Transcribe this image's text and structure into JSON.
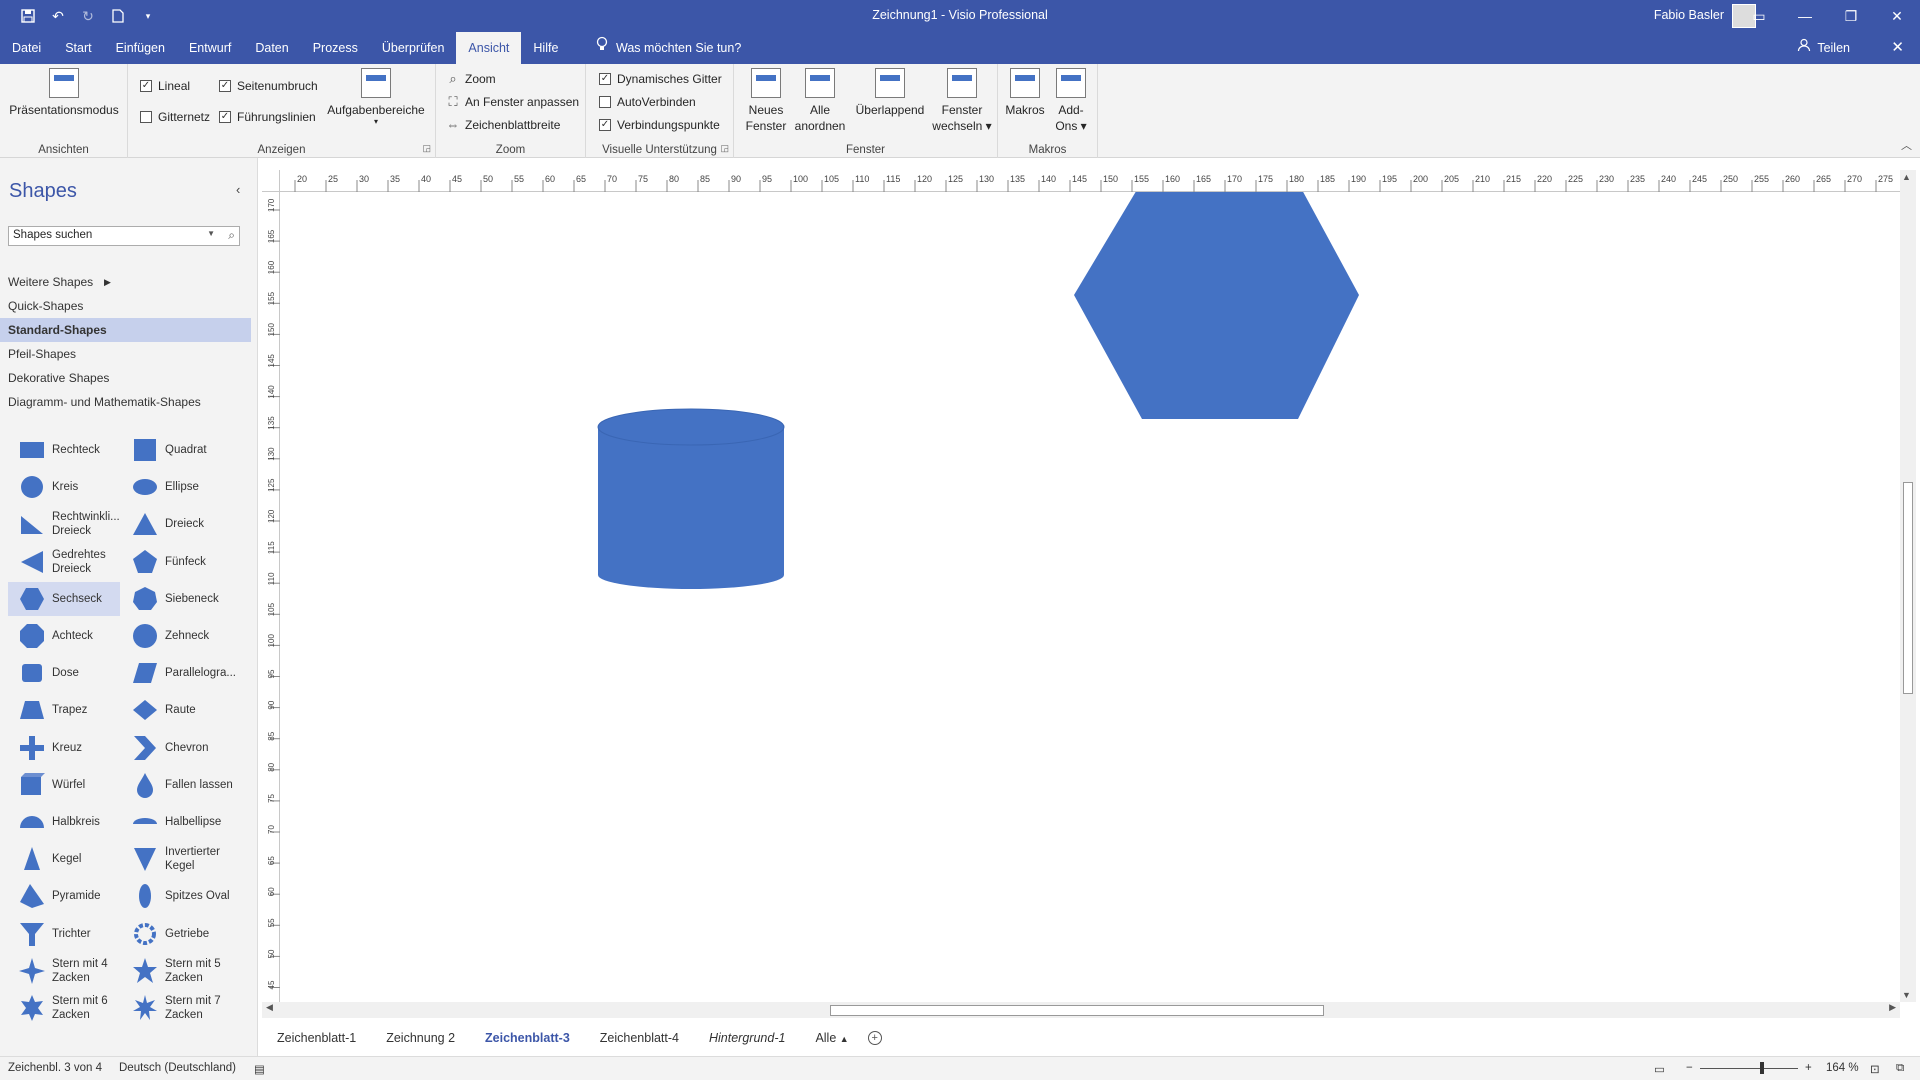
{
  "titlebar": {
    "title": "Zeichnung1  -  Visio Professional",
    "user": "Fabio Basler",
    "qat_icons": [
      "save-icon",
      "undo-icon",
      "redo-icon",
      "new-document-icon",
      "customize-qat-icon"
    ]
  },
  "menu": {
    "tabs": [
      "Datei",
      "Start",
      "Einfügen",
      "Entwurf",
      "Daten",
      "Prozess",
      "Überprüfen",
      "Ansicht",
      "Hilfe"
    ],
    "active_tab": "Ansicht",
    "tellme": "Was möchten Sie tun?",
    "share": "Teilen"
  },
  "ribbon": {
    "ansichten": {
      "label": "Ansichten",
      "presentation": "Präsentationsmodus"
    },
    "anzeigen": {
      "label": "Anzeigen",
      "lineal": "Lineal",
      "gitternetz": "Gitternetz",
      "seitenumbruch": "Seitenumbruch",
      "fuehrungslinien": "Führungslinien",
      "aufgabenbereiche": "Aufgabenbereiche"
    },
    "zoom": {
      "label": "Zoom",
      "zoom": "Zoom",
      "fit": "An Fenster anpassen",
      "pagewidth": "Zeichenblattbreite"
    },
    "visuell": {
      "label": "Visuelle Unterstützung",
      "dyngitter": "Dynamisches Gitter",
      "autoverbinden": "AutoVerbinden",
      "verbindungspunkte": "Verbindungspunkte"
    },
    "fenster": {
      "label": "Fenster",
      "neues_1": "Neues",
      "neues_2": "Fenster",
      "alle_1": "Alle",
      "alle_2": "anordnen",
      "ueberlappend": "Überlappend",
      "wechseln_1": "Fenster",
      "wechseln_2": "wechseln"
    },
    "makros": {
      "label": "Makros",
      "makros": "Makros",
      "addons_1": "Add-",
      "addons_2": "Ons"
    }
  },
  "checkboxes": {
    "lineal": true,
    "gitternetz": false,
    "seitenumbruch": true,
    "fuehrungslinien": true,
    "dyngitter": true,
    "autoverbinden": false,
    "verbindungspunkte": true
  },
  "shapes_pane": {
    "title": "Shapes",
    "search_placeholder": "Shapes suchen",
    "stencils": [
      "Weitere Shapes",
      "Quick-Shapes",
      "Standard-Shapes",
      "Pfeil-Shapes",
      "Dekorative Shapes",
      "Diagramm- und Mathematik-Shapes"
    ],
    "active_stencil": "Standard-Shapes",
    "shapes": [
      [
        "Rechteck",
        "Quadrat"
      ],
      [
        "Kreis",
        "Ellipse"
      ],
      [
        "Rechtwinkli... Dreieck",
        "Dreieck"
      ],
      [
        "Gedrehtes Dreieck",
        "Fünfeck"
      ],
      [
        "Sechseck",
        "Siebeneck"
      ],
      [
        "Achteck",
        "Zehneck"
      ],
      [
        "Dose",
        "Parallelogra..."
      ],
      [
        "Trapez",
        "Raute"
      ],
      [
        "Kreuz",
        "Chevron"
      ],
      [
        "Würfel",
        "Fallen lassen"
      ],
      [
        "Halbkreis",
        "Halbellipse"
      ],
      [
        "Kegel",
        "Invertierter Kegel"
      ],
      [
        "Pyramide",
        "Spitzes Oval"
      ],
      [
        "Trichter",
        "Getriebe"
      ],
      [
        "Stern mit 4 Zacken",
        "Stern mit 5 Zacken"
      ],
      [
        "Stern mit 6 Zacken",
        "Stern mit 7 Zacken"
      ]
    ],
    "active_shape": "Sechseck"
  },
  "ruler": {
    "h_ticks": [
      "20",
      "25",
      "30",
      "35",
      "40",
      "45",
      "50",
      "55",
      "60",
      "65",
      "70",
      "75",
      "80",
      "85",
      "90",
      "95",
      "100",
      "105",
      "110",
      "115",
      "120",
      "125",
      "130",
      "135",
      "140",
      "145",
      "150",
      "155",
      "160",
      "165",
      "170",
      "175",
      "180",
      "185",
      "190",
      "195",
      "200",
      "205",
      "210",
      "215",
      "220",
      "225",
      "230",
      "235",
      "240",
      "245",
      "250",
      "255",
      "260",
      "265",
      "270",
      "275"
    ],
    "v_ticks": [
      "170",
      "165",
      "160",
      "155",
      "150",
      "145",
      "140",
      "135",
      "130",
      "125",
      "120",
      "115",
      "110",
      "105",
      "100",
      "95",
      "90",
      "85",
      "80",
      "75",
      "70",
      "65",
      "60",
      "55",
      "50",
      "45"
    ]
  },
  "canvas": {
    "shape_color": "#4472c4"
  },
  "sheets": {
    "tabs": [
      "Zeichenblatt-1",
      "Zeichnung 2",
      "Zeichenblatt-3",
      "Zeichenblatt-4",
      "Hintergrund-1"
    ],
    "active": "Zeichenblatt-3",
    "all": "Alle"
  },
  "status": {
    "page": "Zeichenbl. 3 von 4",
    "language": "Deutsch (Deutschland)",
    "zoom": "164 %"
  }
}
